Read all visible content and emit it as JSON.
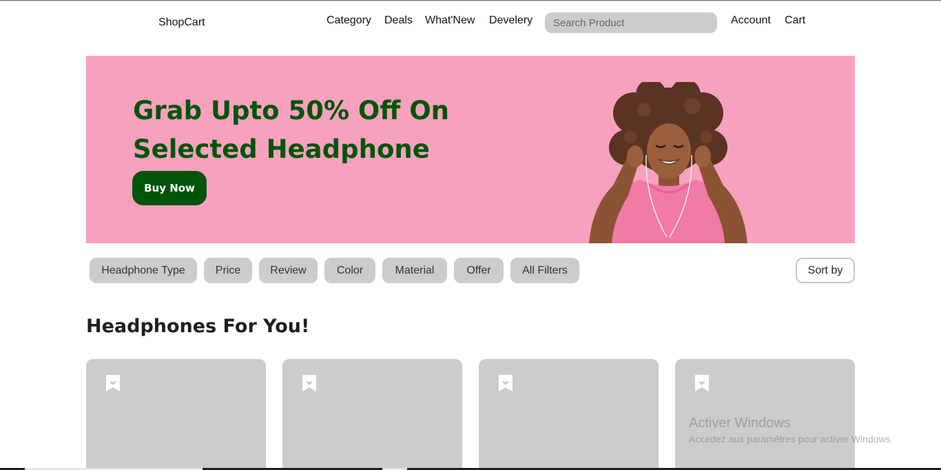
{
  "header": {
    "brand": "ShopCart",
    "nav": [
      "Category",
      "Deals",
      "What'New",
      "Develery"
    ],
    "search_placeholder": "Search Product",
    "account": "Account",
    "cart": "Cart"
  },
  "hero": {
    "title": "Grab Upto 50% Off On Selected Headphone",
    "button": "Buy Now",
    "background_color": "#f8a1be",
    "accent_color": "#00550a"
  },
  "filters": {
    "chips": [
      "Headphone Type",
      "Price",
      "Review",
      "Color",
      "Material",
      "Offer",
      "All Filters"
    ],
    "sort": "Sort by"
  },
  "section": {
    "title": "Headphones For You!"
  },
  "products": [
    {
      "icon": "bookmark-heart-icon"
    },
    {
      "icon": "bookmark-heart-icon"
    },
    {
      "icon": "bookmark-heart-icon"
    },
    {
      "icon": "bookmark-heart-icon"
    }
  ],
  "watermark": {
    "title": "Activer Windows",
    "subtitle": "Accédez aux paramètres pour activer Windows."
  }
}
